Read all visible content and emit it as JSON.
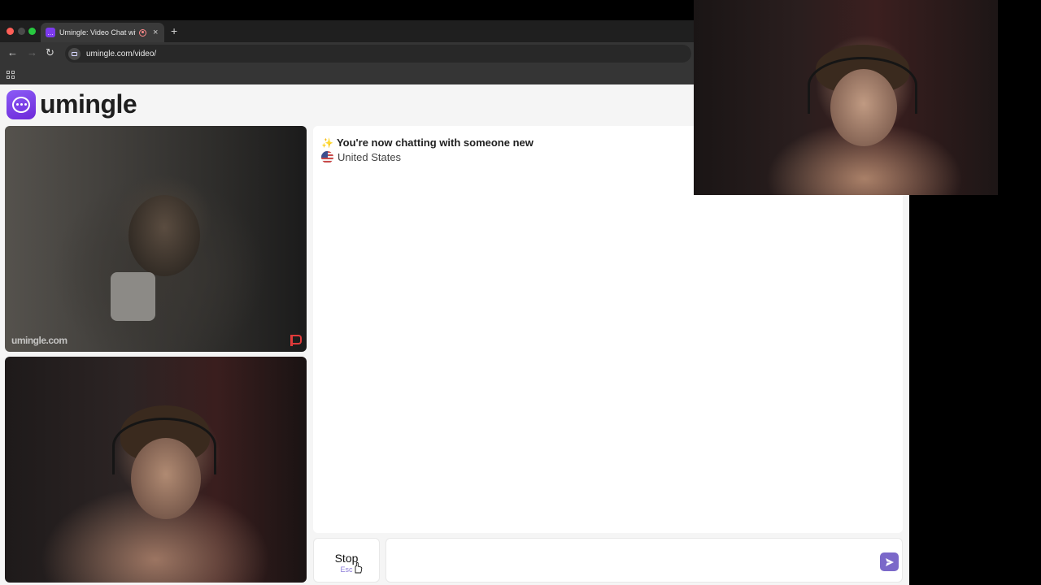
{
  "browser": {
    "tab_title": "Umingle: Video Chat with",
    "tab_close": "×",
    "new_tab": "+",
    "url": "umingle.com/video/",
    "nav": {
      "back": "←",
      "forward": "→",
      "reload": "↻"
    }
  },
  "site": {
    "logo_text": "umingle"
  },
  "stranger_video": {
    "watermark": "umingle",
    "watermark_suffix": ".com"
  },
  "chat": {
    "sparkle": "✨",
    "status": "You're now chatting with someone new",
    "country": "United States"
  },
  "controls": {
    "stop_label": "Stop",
    "stop_shortcut": "Esc",
    "message_placeholder": ""
  },
  "colors": {
    "brand": "#7c3aed",
    "send_button": "#7b68c9",
    "report_flag": "#e03a3a"
  }
}
